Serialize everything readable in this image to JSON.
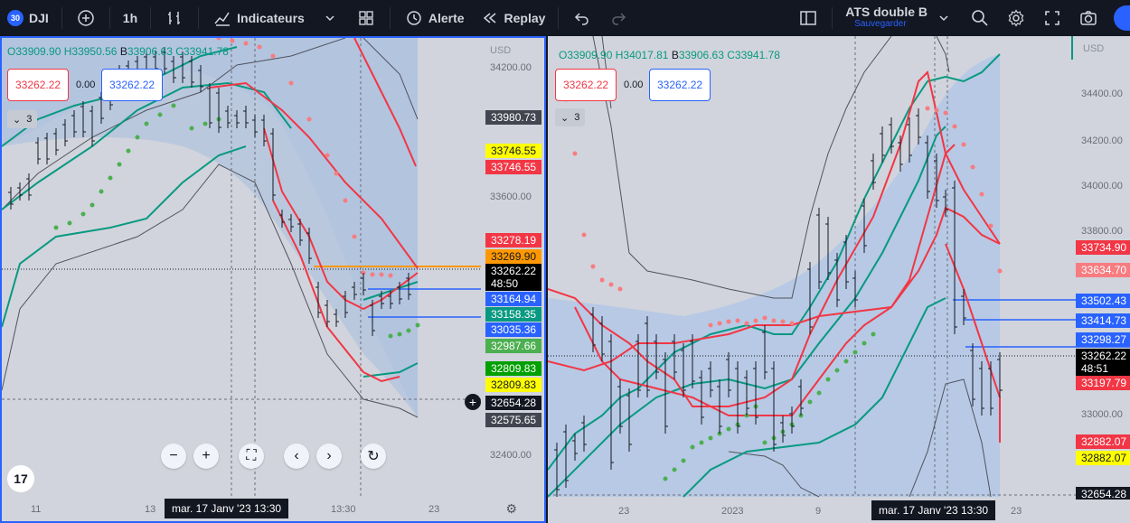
{
  "toolbar": {
    "symbol_badge": "30",
    "symbol": "DJI",
    "interval": "1h",
    "indicators_label": "Indicateurs",
    "alert_label": "Alerte",
    "replay_label": "Replay",
    "layout_name": "ATS double B",
    "layout_status": "Sauvegarder",
    "icons": [
      "add-symbol-icon",
      "bar-style-icon",
      "indicators-icon",
      "chevron-down-icon",
      "templates-icon",
      "alert-icon",
      "replay-icon",
      "undo-icon",
      "redo-icon",
      "layout-icon",
      "chevron-down-icon",
      "search-icon",
      "settings-icon",
      "fullscreen-icon",
      "camera-icon"
    ]
  },
  "left": {
    "ohlc": {
      "o": "33909.90",
      "h": "33950.56",
      "l": "B",
      "lv": "33906.63",
      "c": "33941.78"
    },
    "currency": "USD",
    "sell_price": "33262.22",
    "spread": "0.00",
    "buy_price": "33262.22",
    "collapse_count": "3",
    "axis_ticks": [
      "34200.00",
      "33600.00",
      "32400.00"
    ],
    "price_labels": [
      {
        "text": "33980.73",
        "bg": "#434651",
        "fg": "#ffffff"
      },
      {
        "text": "33746.55",
        "bg": "#ffff00",
        "fg": "#131722"
      },
      {
        "text": "33746.55",
        "bg": "#f23645",
        "fg": "#ffffff"
      },
      {
        "text": "33278.19",
        "bg": "#f23645",
        "fg": "#ffffff"
      },
      {
        "text": "33269.90",
        "bg": "#ff9800",
        "fg": "#131722"
      },
      {
        "text": "33164.94",
        "bg": "#2962ff",
        "fg": "#ffffff"
      },
      {
        "text": "33158.35",
        "bg": "#089981",
        "fg": "#ffffff"
      },
      {
        "text": "33035.36",
        "bg": "#2962ff",
        "fg": "#ffffff"
      },
      {
        "text": "32987.66",
        "bg": "#4caf50",
        "fg": "#ffffff"
      },
      {
        "text": "32809.83",
        "bg": "#00a000",
        "fg": "#ffffff"
      },
      {
        "text": "32809.83",
        "bg": "#ffff00",
        "fg": "#131722"
      },
      {
        "text": "32654.28",
        "bg": "#131722",
        "fg": "#ffffff"
      },
      {
        "text": "32575.65",
        "bg": "#434651",
        "fg": "#ffffff"
      }
    ],
    "current_price": "33262.22",
    "countdown": "48:50",
    "time_labels": [
      "11",
      "13",
      "13:30",
      "23"
    ],
    "cross_time": "mar. 17 Janv '23   13:30",
    "logo": "17"
  },
  "right": {
    "ohlc": {
      "o": "33909.90",
      "h": "34017.81",
      "l": "B",
      "lv": "33906.63",
      "c": "33941.78"
    },
    "currency": "USD",
    "sell_price": "33262.22",
    "spread": "0.00",
    "buy_price": "33262.22",
    "collapse_count": "3",
    "axis_ticks": [
      "34400.00",
      "34200.00",
      "34000.00",
      "33800.00",
      "33000.00"
    ],
    "price_labels": [
      {
        "text": "33734.90",
        "bg": "#f23645",
        "fg": "#ffffff"
      },
      {
        "text": "33634.70",
        "bg": "#f77c80",
        "fg": "#ffffff"
      },
      {
        "text": "33502.43",
        "bg": "#2962ff",
        "fg": "#ffffff"
      },
      {
        "text": "33414.73",
        "bg": "#2962ff",
        "fg": "#ffffff"
      },
      {
        "text": "33298.27",
        "bg": "#2962ff",
        "fg": "#ffffff"
      },
      {
        "text": "33197.79",
        "bg": "#f23645",
        "fg": "#ffffff"
      },
      {
        "text": "32882.07",
        "bg": "#f23645",
        "fg": "#ffffff"
      },
      {
        "text": "32882.07",
        "bg": "#ffff00",
        "fg": "#131722"
      },
      {
        "text": "32654.28",
        "bg": "#131722",
        "fg": "#ffffff"
      }
    ],
    "current_price": "33262.22",
    "countdown": "48:51",
    "time_labels": [
      "23",
      "2023",
      "9",
      "23"
    ],
    "cross_time": "mar. 17 Janv '23   13:30"
  }
}
